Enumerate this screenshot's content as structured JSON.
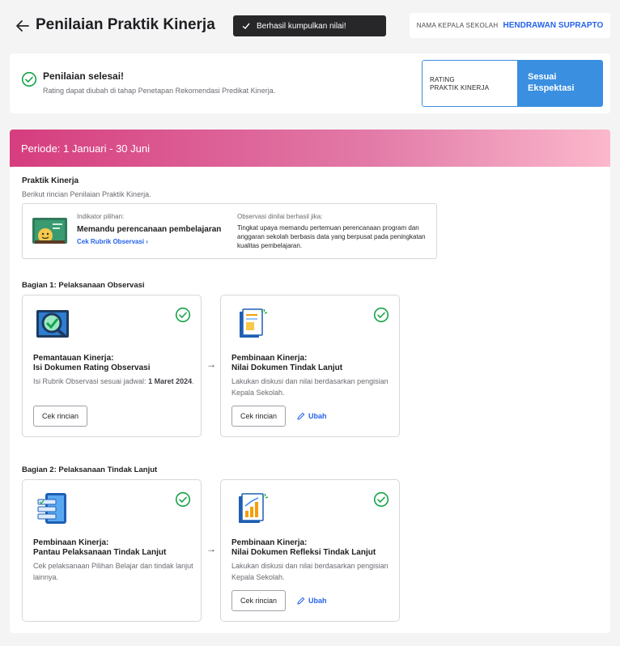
{
  "header": {
    "title": "Penilaian Praktik Kinerja",
    "toast": "Berhasil kumpulkan nilai!",
    "principal_label": "NAMA KEPALA SEKOLAH",
    "principal_name": "HENDRAWAN SUPRAPTO"
  },
  "status": {
    "title": "Penilaian selesai!",
    "subtitle": "Rating dapat diubah di tahap Penetapan Rekomendasi Predikat Kinerja.",
    "rating_label_1": "RATING",
    "rating_label_2": "PRAKTIK KINERJA",
    "rating_value_1": "Sesuai",
    "rating_value_2": "Ekspektasi"
  },
  "period": {
    "label": "Periode: 1 Januari - 30 Juni"
  },
  "praktik": {
    "title": "Praktik Kinerja",
    "subtitle": "Berikut rincian Penilaian Praktik Kinerja.",
    "indicator_label": "Indikator pilihan:",
    "indicator_value": "Memandu perencanaan pembelajaran",
    "rubric_link": "Cek Rubrik Observasi",
    "observation_label": "Observasi dinilai berhasil jika:",
    "observation_text": "Tingkat upaya memandu pertemuan perencanaan program dan anggaran sekolah berbasis data yang berpusat pada peningkatan kualitas pembelajaran."
  },
  "section1": {
    "title": "Bagian 1: Pelaksanaan Observasi",
    "card1": {
      "title_1": "Pemantauan Kinerja:",
      "title_2": "Isi Dokumen Rating Observasi",
      "desc_pre": "Isi Rubrik Observasi sesuai jadwal: ",
      "desc_bold": "1 Maret 2024",
      "desc_post": ".",
      "button": "Cek rincian"
    },
    "card2": {
      "title_1": "Pembinaan Kinerja:",
      "title_2": "Nilai Dokumen Tindak Lanjut",
      "desc": "Lakukan diskusi dan nilai berdasarkan pengisian Kepala Sekolah.",
      "button": "Cek rincian",
      "edit": "Ubah"
    }
  },
  "section2": {
    "title": "Bagian 2: Pelaksanaan Tindak Lanjut",
    "card1": {
      "title_1": "Pembinaan Kinerja:",
      "title_2": "Pantau Pelaksanaan Tindak Lanjut",
      "desc": "Cek pelaksanaan Pilihan Belajar dan tindak lanjut lainnya."
    },
    "card2": {
      "title_1": "Pembinaan Kinerja:",
      "title_2": "Nilai Dokumen Refleksi Tindak Lanjut",
      "desc": "Lakukan diskusi dan nilai berdasarkan pengisian Kepala Sekolah.",
      "button": "Cek rincian",
      "edit": "Ubah"
    }
  },
  "colors": {
    "accent": "#2563eb",
    "success": "#16a34a",
    "rating_bg": "#3b8fe0",
    "period_gradient_start": "#d63d7e",
    "period_gradient_end": "#fbb8cc"
  }
}
